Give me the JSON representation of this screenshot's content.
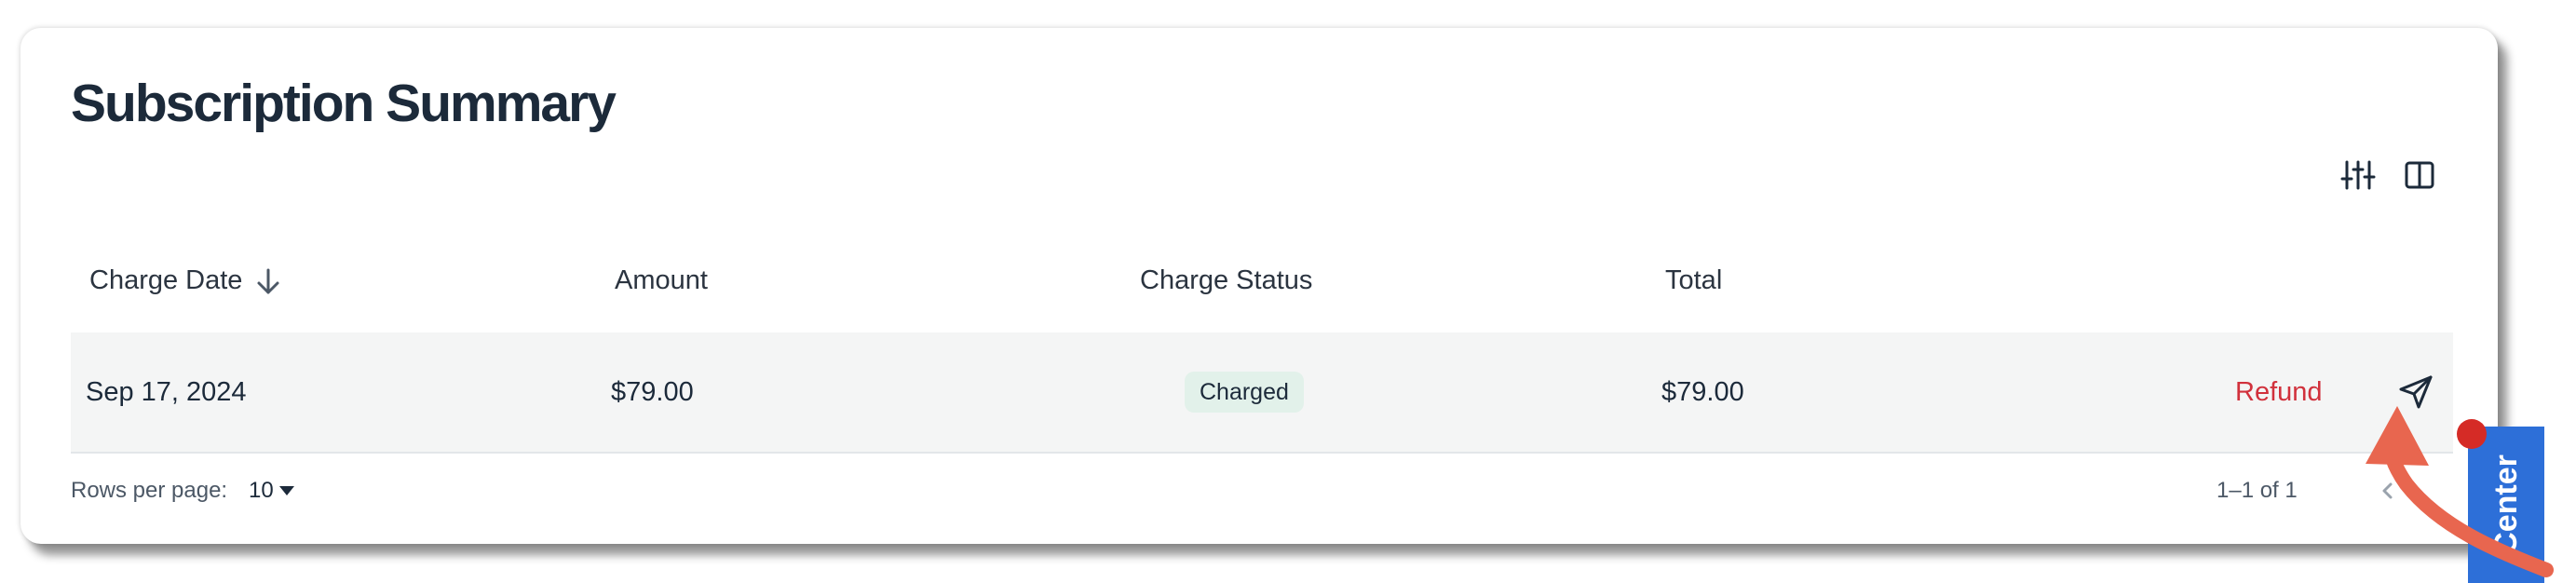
{
  "page": {
    "title": "Subscription Summary"
  },
  "toolbar": {
    "filter_icon": "sliders-icon",
    "columns_icon": "columns-icon"
  },
  "table": {
    "columns": [
      {
        "label": "Charge Date",
        "sort": "descending"
      },
      {
        "label": "Amount"
      },
      {
        "label": "Charge Status"
      },
      {
        "label": "Total"
      }
    ],
    "rows": [
      {
        "charge_date": "Sep 17, 2024",
        "amount": "$79.00",
        "charge_status": "Charged",
        "total": "$79.00",
        "action_label": "Refund",
        "action_icon": "send-icon"
      }
    ]
  },
  "pagination": {
    "rows_per_page_label": "Rows per page:",
    "rows_per_page_value": "10",
    "range_text": "1–1 of 1"
  },
  "help_tab": {
    "label": "Center"
  },
  "colors": {
    "title": "#1c2a3a",
    "refund": "#d1313c",
    "status_badge_bg": "#e2f1ea",
    "row_bg": "#f4f5f5",
    "help_tab": "#2d6fd8",
    "annotation_arrow": "#e8664f",
    "annotation_dot": "#d52b26"
  }
}
